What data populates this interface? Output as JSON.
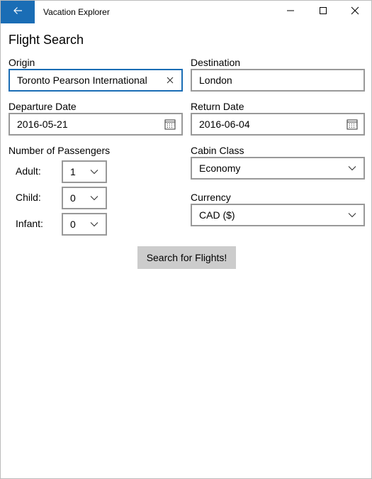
{
  "window": {
    "title": "Vacation Explorer",
    "accent_color": "#1a6db5",
    "back_icon": "back-arrow-icon",
    "controls": [
      "minimize-icon",
      "maximize-icon",
      "close-icon"
    ]
  },
  "page": {
    "title": "Flight Search"
  },
  "origin": {
    "label": "Origin",
    "value": "Toronto Pearson International",
    "clear_icon": "clear-icon"
  },
  "destination": {
    "label": "Destination",
    "value": "London"
  },
  "departure": {
    "label": "Departure Date",
    "value": "2016-05-21",
    "icon": "calendar-icon"
  },
  "return_date": {
    "label": "Return Date",
    "value": "2016-06-04",
    "icon": "calendar-icon"
  },
  "passengers": {
    "label": "Number of Passengers",
    "adult": {
      "label": "Adult:",
      "value": "1"
    },
    "child": {
      "label": "Child:",
      "value": "0"
    },
    "infant": {
      "label": "Infant:",
      "value": "0"
    }
  },
  "cabin": {
    "label": "Cabin Class",
    "value": "Economy"
  },
  "currency": {
    "label": "Currency",
    "value": "CAD ($)"
  },
  "search_button": {
    "label": "Search for Flights!"
  }
}
